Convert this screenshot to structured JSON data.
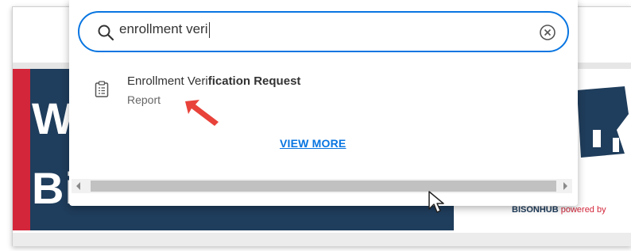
{
  "search": {
    "value": "enrollment veri",
    "icon": "search-icon",
    "clear_icon": "clear-icon"
  },
  "results": [
    {
      "title_normal": "Enrollment Veri",
      "title_bold": "fication Request",
      "subtitle": "Report",
      "icon": "report-icon"
    }
  ],
  "view_more_label": "VIEW MORE",
  "hero": {
    "line1": "W",
    "line2": "Bisonhub!"
  },
  "brand": {
    "name": "BISONHUB",
    "suffix": " powered by"
  },
  "colors": {
    "accent": "#0875e1",
    "hero_bg": "#1f3d5c",
    "hero_red": "#d3263a",
    "annotation_arrow": "#e8423a"
  }
}
